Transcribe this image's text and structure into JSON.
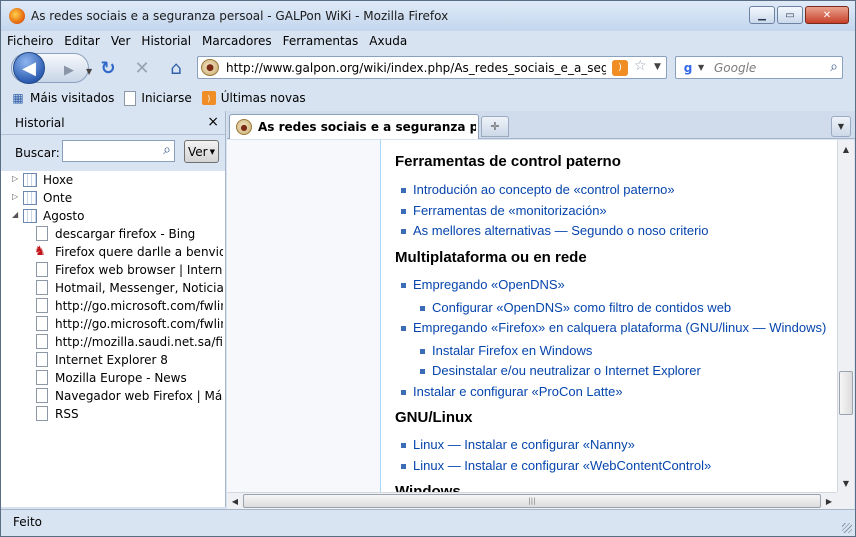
{
  "window": {
    "title": "As redes sociais e a seguranza persoal - GALPon WiKi - Mozilla Firefox"
  },
  "menu": [
    "Ficheiro",
    "Editar",
    "Ver",
    "Historial",
    "Marcadores",
    "Ferramentas",
    "Axuda"
  ],
  "nav": {
    "url": "http://www.galpon.org/wiki/index.php/As_redes_sociais_e_a_seguranza_persoal",
    "search_placeholder": "Google"
  },
  "bookmarks": [
    "Máis visitados",
    "Iniciarse",
    "Últimas novas"
  ],
  "sidebar": {
    "title": "Historial",
    "search_label": "Buscar:",
    "view_button": "Ver",
    "folders": [
      "Hoxe",
      "Onte",
      "Agosto"
    ],
    "items": [
      "descargar firefox - Bing",
      "Firefox quere darlle a benvida",
      "Firefox web browser | International",
      "Hotmail, Messenger, Noticias, Deportes",
      "http://go.microsoft.com/fwlink/?LinkId",
      "http://go.microsoft.com/fwlink/?LinkId",
      "http://mozilla.saudi.net.sa/firefox",
      "Internet Explorer 8",
      "Mozilla Europe - News",
      "Navegador web Firefox | Más rápido",
      "RSS"
    ]
  },
  "tab": {
    "label": "As redes sociais e a seguranza persoal - GALPon WiKi"
  },
  "article": {
    "sections": [
      {
        "heading": "Ferramentas de control paterno",
        "items": [
          "Introdución ao concepto de «control paterno»",
          "Ferramentas de «monitorización»",
          "As mellores alternativas — Segundo o noso criterio"
        ]
      },
      {
        "heading": "Multiplataforma ou en rede",
        "items": [
          "Empregando «OpenDNS»",
          "Configurar «OpenDNS» como filtro de contidos web",
          "Empregando «Firefox» en calquera plataforma (GNU/linux — Windows)",
          "Instalar Firefox en Windows",
          "Desinstalar e/ou neutralizar o Internet Explorer",
          "Instalar e configurar «ProCon Latte»"
        ]
      },
      {
        "heading": "GNU/Linux",
        "items": [
          "Linux — Instalar e configurar «Nanny»",
          "Linux — Instalar e configurar «WebContentControl»"
        ]
      },
      {
        "heading": "Windows",
        "items": []
      }
    ]
  },
  "status": {
    "text": "Feito"
  },
  "icons": [
    "firefox-logo",
    "back-arrow",
    "forward-arrow",
    "reload",
    "stop",
    "home",
    "rss-feed",
    "bookmark-star",
    "google",
    "search-magnifier",
    "calendar-folder",
    "page",
    "close"
  ]
}
